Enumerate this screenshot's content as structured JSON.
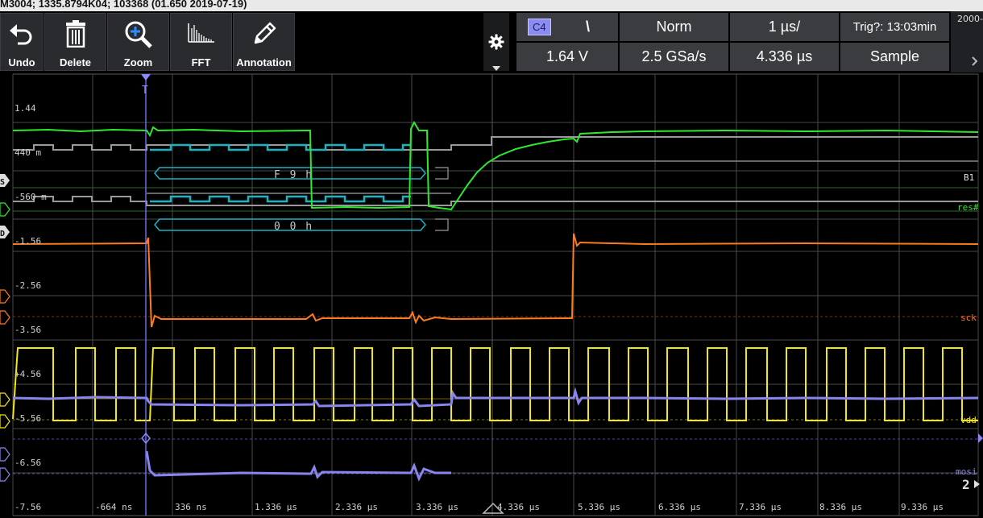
{
  "title_bar": {
    "text": "M3004; 1335.8794K04; 103368 (01.650 2019-07-19)"
  },
  "toolbar": {
    "buttons": [
      {
        "id": "undo",
        "label": "Undo",
        "icon": "undo-arrow-icon"
      },
      {
        "id": "delete",
        "label": "Delete",
        "icon": "trash-icon"
      },
      {
        "id": "zoom",
        "label": "Zoom",
        "icon": "zoom-icon"
      },
      {
        "id": "fft",
        "label": "FFT",
        "icon": "fft-spectrum-icon"
      },
      {
        "id": "annotation",
        "label": "Annotation",
        "icon": "pen-icon"
      }
    ],
    "settings_icon": "gear-icon"
  },
  "trigger": {
    "source": "C4",
    "slope_symbol": "\\",
    "mode": "Norm",
    "timebase": "1 µs/",
    "status": "Trig?: 13:03min",
    "level": "1.64 V",
    "sample_rate": "2.5 GSa/s",
    "position": "4.336 µs",
    "acquisition": "Sample",
    "corner_text": "2000-"
  },
  "scope": {
    "y_labels": [
      "1.44",
      "440 m",
      "-560 m",
      "-1.56",
      "-2.56",
      "-3.56",
      "+4.56",
      "-5.56",
      "-6.56",
      "-7.56"
    ],
    "x_labels": [
      "-664 ns",
      "336 ns",
      "1.336 µs",
      "2.336 µs",
      "3.336 µs",
      "4.336 µs",
      "5.336 µs",
      "6.336 µs",
      "7.336 µs",
      "8.336 µs",
      "9.336 µs"
    ],
    "bus_values": [
      "F 9 h",
      "0 0 h"
    ],
    "right_labels": {
      "b1": "B1",
      "res": "res#",
      "sck": "sck",
      "vdd": "vdd",
      "mosi": "mosi",
      "page": "2"
    },
    "left_markers": [
      "S",
      "D"
    ]
  },
  "colors": {
    "green": "#2ee82e",
    "orange": "#ff7a1a",
    "yellow": "#f2e80c",
    "purple": "#8a85ee",
    "teal": "#19b3c2",
    "grid": "#4a4a4a",
    "cursor": "#7a7aff"
  }
}
